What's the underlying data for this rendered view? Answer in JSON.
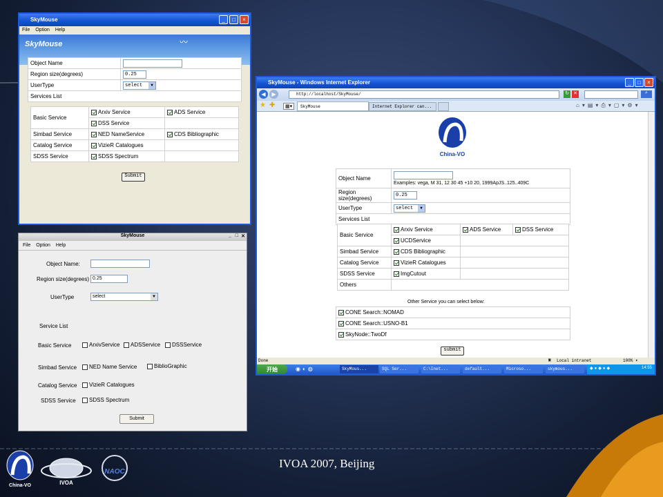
{
  "slide": {
    "footer": "IVOA 2007, Beijing"
  },
  "win1": {
    "title": "SkyMouse",
    "menu": [
      "File",
      "Option",
      "Help"
    ],
    "banner": "SkyMouse",
    "rows": {
      "object_name": "Object Name",
      "region": "Region size(degrees)",
      "region_value": "0.25",
      "usertype": "UserType",
      "usertype_value": "select",
      "services_list": "Services List"
    },
    "services": [
      {
        "name": "Basic Service",
        "a": "Arxiv Service",
        "b": "ADS Service",
        "c": "DSS Service"
      },
      {
        "name": "Simbad Service",
        "a": "NED NameService",
        "b": "CDS Bibliographic"
      },
      {
        "name": "Catalog Service",
        "a": "VizieR Catalogues"
      },
      {
        "name": "SDSS Service",
        "a": "SDSS Spectrum"
      }
    ],
    "submit": "Submit"
  },
  "win2": {
    "title": "SkyMouse",
    "menu": [
      "File",
      "Option",
      "Help"
    ],
    "object_name": "Object Name:",
    "region": "Region size(degrees)",
    "region_value": "0.25",
    "usertype": "UserType",
    "usertype_value": "select",
    "services_list": "Service List",
    "basic": "Basic Service",
    "basic_a": "ArxivService",
    "basic_b": "ADSService",
    "basic_c": "DSSService",
    "simbad": "Simbad Service",
    "simbad_a": "NED Name Service",
    "simbad_b": "BiblioGraphic",
    "catalog": "Catalog Service",
    "catalog_a": "VizieR Catalogues",
    "sdss": "SDSS Service",
    "sdss_a": "SDSS Spectrum",
    "submit": "Submit"
  },
  "ie": {
    "title": "SkyMouse - Windows Internet Explorer",
    "address": "http://localhost/SkyMouse/",
    "tab1": "SkyMouse",
    "tab2": "Internet Explorer can...",
    "logo_text": "China-VO",
    "object_name": "Object Name",
    "examples": "Examples: vega, M 31, 12 30 45 +10 20, 1999ApJS..125..409C",
    "region": "Region size(degrees)",
    "region_value": "0.25",
    "usertype": "UserType",
    "usertype_value": "select",
    "services_list": "Services List",
    "basic": "Basic Service",
    "arxiv": "Arxiv Service",
    "ads": "ADS Service",
    "dss": "DSS Service",
    "ucd": "UCDService",
    "simbad": "Simbad Service",
    "cds": "CDS Bibliographic",
    "catalog": "Catalog Service",
    "vizier": "VizieR Catalogues",
    "sdss": "SDSS Service",
    "imgcutout": "ImgCutout",
    "others": "Others",
    "other_heading": "Other Service you can select below:",
    "cone1": "CONE Search::NOMAD",
    "cone2": "CONE Search::USNO-B1",
    "skynode": "SkyNode::TwoDf",
    "submit": "submit",
    "status": "Done",
    "zone": "Local intranet",
    "zoom": "100%"
  },
  "taskbar": {
    "start": "开始",
    "items": [
      "SkyMous...",
      "SQL Ser...",
      "C:\\Inet...",
      "default...",
      "Microso...",
      "skymous..."
    ],
    "clock": "14:55"
  },
  "logos": {
    "chinavo": "China-VO",
    "ivoa": "IVOA",
    "naoc": "NAOC"
  },
  "colors": {
    "xp_blue": "#1654d4",
    "slide_bg": "#26365a",
    "accent_swoosh": "#d98a10"
  }
}
